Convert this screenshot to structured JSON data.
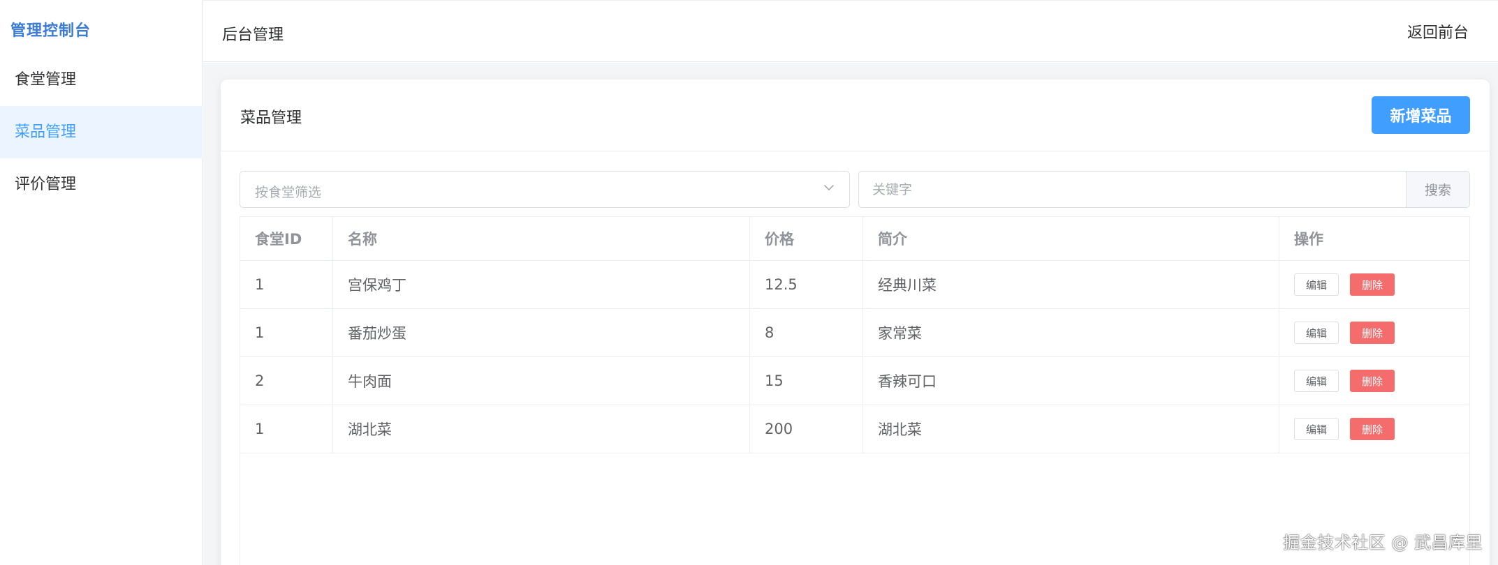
{
  "sidebar": {
    "brand": "管理控制台",
    "items": [
      {
        "label": "食堂管理",
        "active": false
      },
      {
        "label": "菜品管理",
        "active": true
      },
      {
        "label": "评价管理",
        "active": false
      }
    ]
  },
  "header": {
    "title": "后台管理",
    "back_link": "返回前台"
  },
  "card": {
    "title": "菜品管理",
    "add_button": "新增菜品"
  },
  "filters": {
    "canteen_select_placeholder": "按食堂筛选",
    "keyword_placeholder": "关键字",
    "search_button": "搜索"
  },
  "table": {
    "columns": [
      "食堂ID",
      "名称",
      "价格",
      "简介",
      "操作"
    ],
    "rows": [
      {
        "canteen_id": "1",
        "name": "宫保鸡丁",
        "price": "12.5",
        "desc": "经典川菜"
      },
      {
        "canteen_id": "1",
        "name": "番茄炒蛋",
        "price": "8",
        "desc": "家常菜"
      },
      {
        "canteen_id": "2",
        "name": "牛肉面",
        "price": "15",
        "desc": "香辣可口"
      },
      {
        "canteen_id": "1",
        "name": "湖北菜",
        "price": "200",
        "desc": "湖北菜"
      }
    ],
    "edit_label": "编辑",
    "delete_label": "删除"
  },
  "watermark": "掘金技术社区 @ 武昌库里",
  "colors": {
    "primary": "#409eff",
    "danger": "#f56c6c",
    "active_bg": "#ecf5ff",
    "brand": "#3a7bd5"
  }
}
